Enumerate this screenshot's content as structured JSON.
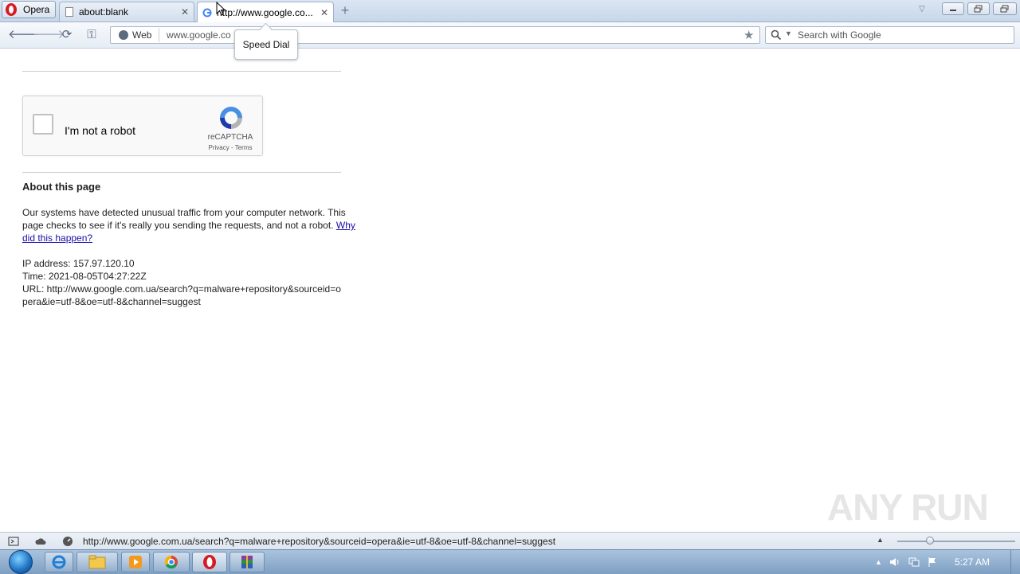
{
  "browser": {
    "menu_label": "Opera",
    "tabs": [
      {
        "title": "about:blank"
      },
      {
        "title": "http://www.google.co..."
      }
    ],
    "address": {
      "badge": "Web",
      "url": "www.google.co"
    },
    "search": {
      "placeholder": "Search with Google"
    },
    "tooltip": "Speed Dial",
    "status_url": "http://www.google.com.ua/search?q=malware+repository&sourceid=opera&ie=utf-8&oe=utf-8&channel=suggest"
  },
  "page": {
    "recaptcha": {
      "label": "I'm not a robot",
      "brand": "reCAPTCHA",
      "links": "Privacy - Terms"
    },
    "about_title": "About this page",
    "about_text": "Our systems have detected unusual traffic from your computer network. This page checks to see if it's really you sending the requests, and not a robot.",
    "about_link": "Why did this happen?",
    "ip_line": "IP address: 157.97.120.10",
    "time_line": "Time: 2021-08-05T04:27:22Z",
    "url_line": "URL: http://www.google.com.ua/search?q=malware+repository&sourceid=opera&ie=utf-8&oe=utf-8&channel=suggest"
  },
  "watermark": "ANY RUN",
  "taskbar": {
    "clock": "5:27 AM"
  },
  "colors": {
    "link": "#1a0dab",
    "opera_red": "#d71921",
    "recaptcha_blue": "#4a90e2"
  }
}
